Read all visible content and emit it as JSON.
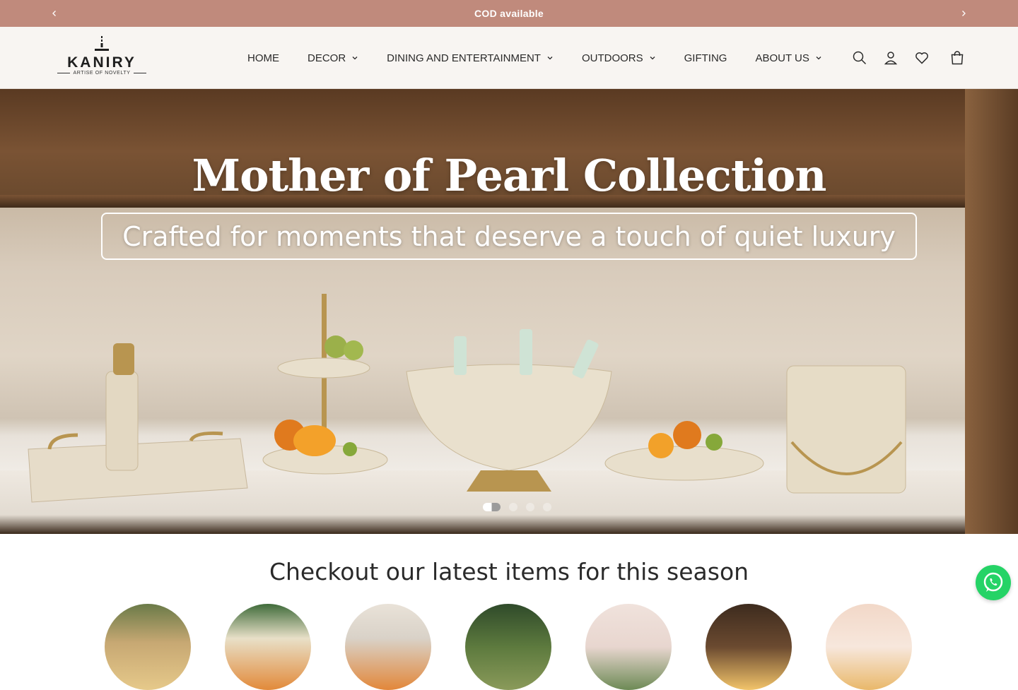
{
  "announcement": {
    "text": "COD available",
    "prev_icon": "chevron-left-icon",
    "next_icon": "chevron-right-icon"
  },
  "brand": {
    "name": "KANIRY",
    "tagline": "ARTISE OF NOVELTY"
  },
  "nav": {
    "items": [
      {
        "label": "HOME",
        "dropdown": false
      },
      {
        "label": "DECOR",
        "dropdown": true
      },
      {
        "label": "DINING AND ENTERTAINMENT",
        "dropdown": true
      },
      {
        "label": "OUTDOORS",
        "dropdown": true
      },
      {
        "label": "GIFTING",
        "dropdown": false
      },
      {
        "label": "ABOUT US",
        "dropdown": true
      }
    ]
  },
  "header_icons": [
    "search-icon",
    "account-icon",
    "wishlist-heart-icon",
    "cart-icon"
  ],
  "hero": {
    "title": "Mother of Pearl Collection",
    "subtitle": "Crafted for moments that deserve a touch of quiet luxury",
    "slides_count": 4,
    "active_slide": 1
  },
  "season": {
    "title": "Checkout our latest items for this season"
  },
  "colors": {
    "announcement_bg": "#c08a7c",
    "header_bg": "#f8f5f2",
    "whatsapp": "#25d366"
  }
}
